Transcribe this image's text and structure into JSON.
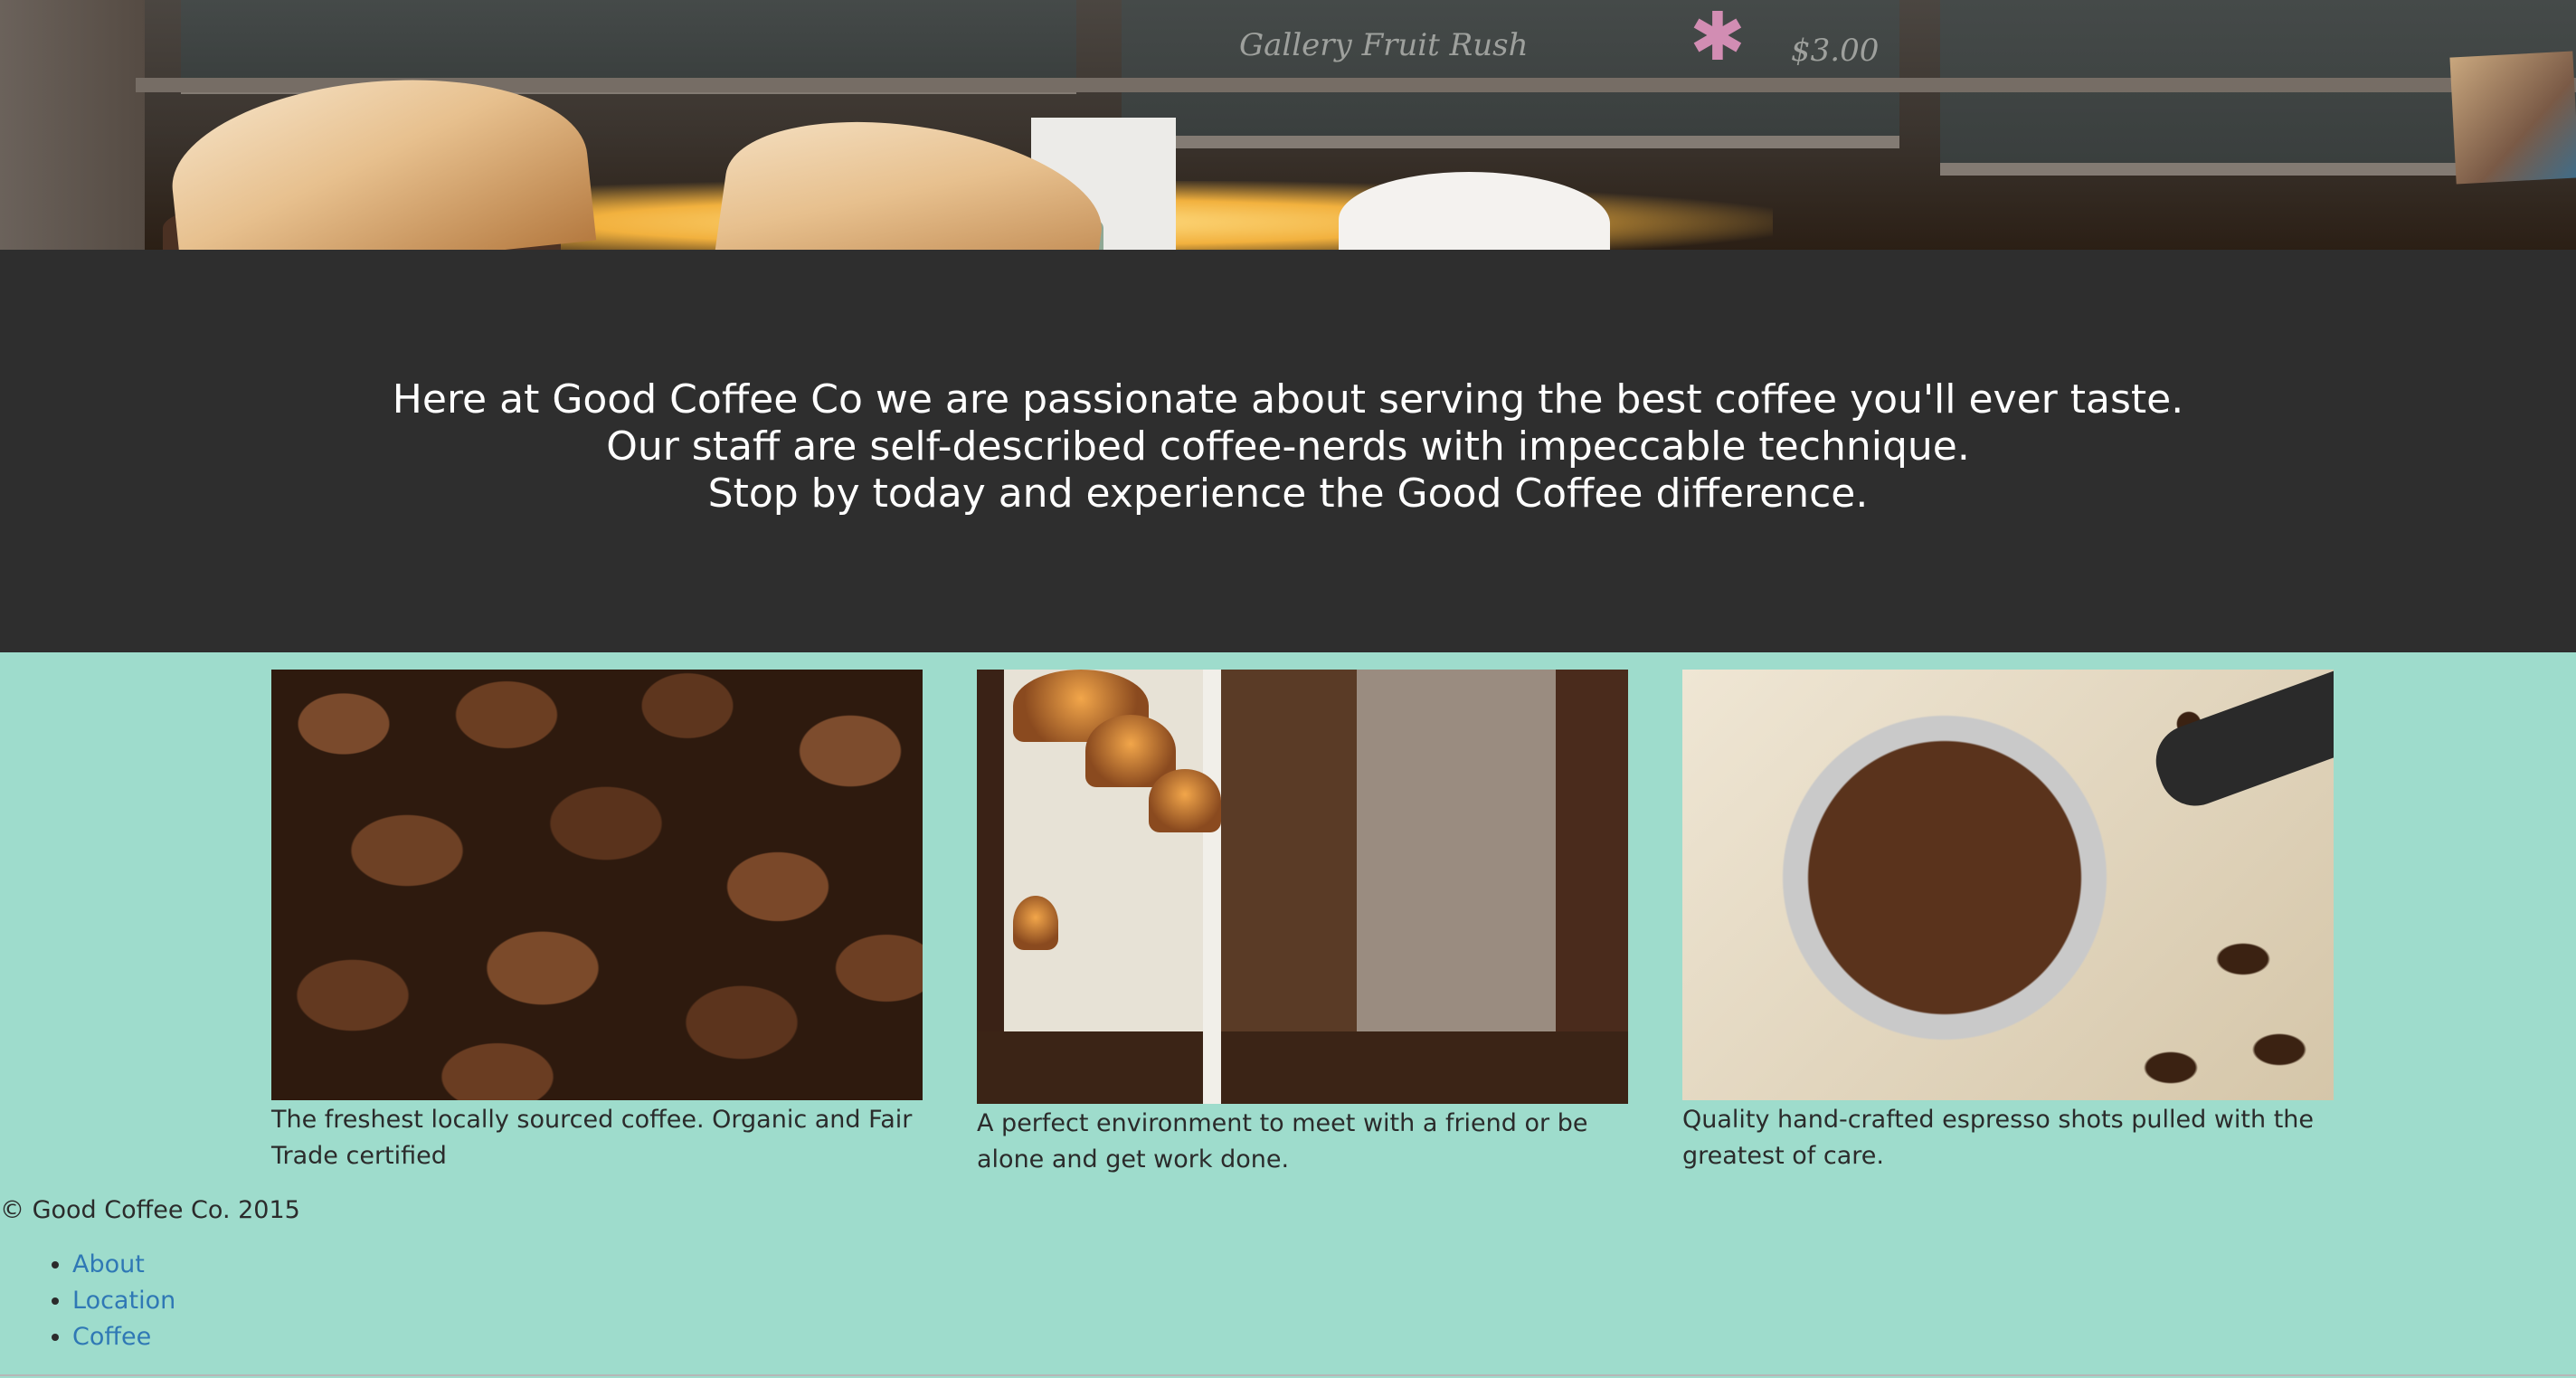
{
  "hero": {
    "chalkboard_text": [
      "Gallery Fruit Rush",
      "$3.00"
    ]
  },
  "band": {
    "lines": [
      "Here at Good Coffee Co we are passionate about serving the best coffee you'll ever taste.",
      "Our staff are self-described coffee-nerds with impeccable technique.",
      "Stop by today and experience the Good Coffee difference."
    ]
  },
  "features": [
    {
      "image": "coffee-beans-photo",
      "caption": "The freshest locally sourced coffee. Organic and Fair Trade certified"
    },
    {
      "image": "cafe-interior-photo",
      "caption": "A perfect environment to meet with a friend or be alone and get work done."
    },
    {
      "image": "espresso-portafilter-photo",
      "caption": "Quality hand-crafted espresso shots pulled with the greatest of care."
    }
  ],
  "footer": {
    "copyright": "© Good Coffee Co. 2015",
    "nav": [
      "About",
      "Location",
      "Coffee"
    ]
  },
  "colors": {
    "page_background": "#9edccc",
    "band_background": "#2e2e2e",
    "link": "#2f78b5"
  }
}
